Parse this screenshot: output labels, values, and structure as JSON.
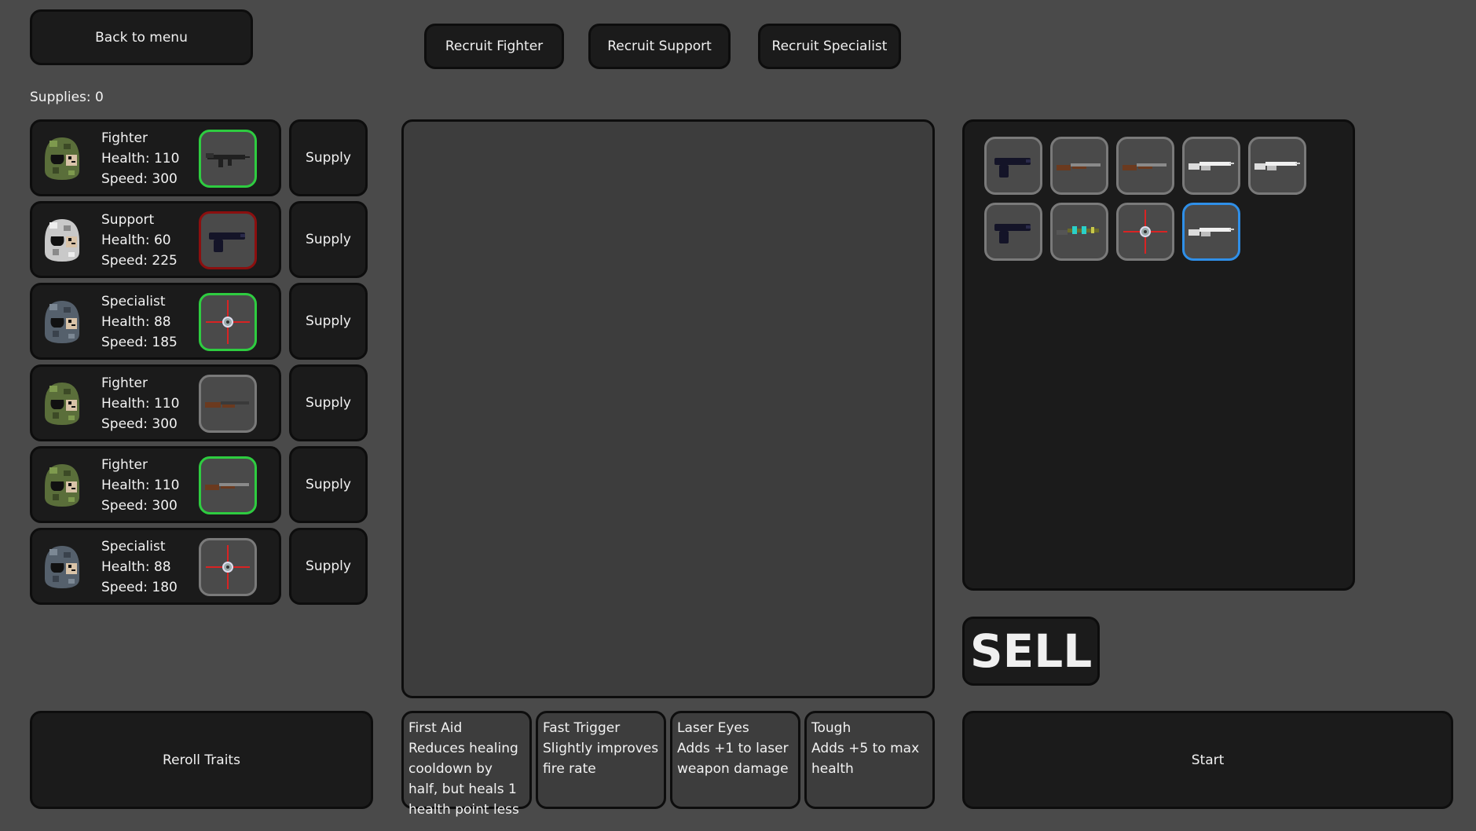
{
  "header": {
    "back_label": "Back to menu",
    "recruit_fighter_label": "Recruit Fighter",
    "recruit_support_label": "Recruit Support",
    "recruit_specialist_label": "Recruit Specialist"
  },
  "supplies_text": "Supplies: 0",
  "units": [
    {
      "role": "Fighter",
      "health": "Health: 110",
      "speed": "Speed: 300",
      "helmet": "camo",
      "weapon_icon": "smg-icon",
      "slot_state": "green",
      "supply_label": "Supply"
    },
    {
      "role": "Support",
      "health": "Health: 60",
      "speed": "Speed: 225",
      "helmet": "white",
      "weapon_icon": "pistol-icon",
      "slot_state": "red",
      "supply_label": "Supply"
    },
    {
      "role": "Specialist",
      "health": "Health: 88",
      "speed": "Speed: 185",
      "helmet": "grey",
      "weapon_icon": "crosshair-icon",
      "slot_state": "green",
      "supply_label": "Supply"
    },
    {
      "role": "Fighter",
      "health": "Health: 110",
      "speed": "Speed: 300",
      "helmet": "camo",
      "weapon_icon": "rifle-icon",
      "slot_state": "grey",
      "supply_label": "Supply"
    },
    {
      "role": "Fighter",
      "health": "Health: 110",
      "speed": "Speed: 300",
      "helmet": "camo",
      "weapon_icon": "shotgun-icon",
      "slot_state": "green",
      "supply_label": "Supply"
    },
    {
      "role": "Specialist",
      "health": "Health: 88",
      "speed": "Speed: 180",
      "helmet": "grey",
      "weapon_icon": "crosshair-icon",
      "slot_state": "grey",
      "supply_label": "Supply"
    }
  ],
  "inventory": [
    {
      "icon": "pistol-icon",
      "selected": false
    },
    {
      "icon": "shotgun-icon",
      "selected": false
    },
    {
      "icon": "shotgun-icon",
      "selected": false
    },
    {
      "icon": "silver-rifle-icon",
      "selected": false
    },
    {
      "icon": "silver-rifle-icon",
      "selected": false
    },
    {
      "icon": "pistol-icon",
      "selected": false
    },
    {
      "icon": "laser-rifle-icon",
      "selected": false
    },
    {
      "icon": "crosshair-icon",
      "selected": false
    },
    {
      "icon": "silver-rifle-icon",
      "selected": true
    }
  ],
  "sell_label": "SELL",
  "reroll_label": "Reroll Traits",
  "start_label": "Start",
  "traits": [
    {
      "name": "First Aid",
      "description": "Reduces healing cooldown by half, but heals 1 health point less"
    },
    {
      "name": "Fast Trigger",
      "description": "Slightly improves fire rate"
    },
    {
      "name": "Laser Eyes",
      "description": "Adds +1 to laser weapon damage"
    },
    {
      "name": "Tough",
      "description": "Adds +5 to max health"
    }
  ],
  "colors": {
    "background": "#4a4a4a",
    "panel": "#1b1b1b",
    "slot_green": "#2ecc40",
    "slot_red": "#8b0f0f",
    "slot_selected": "#2f8fe8"
  }
}
